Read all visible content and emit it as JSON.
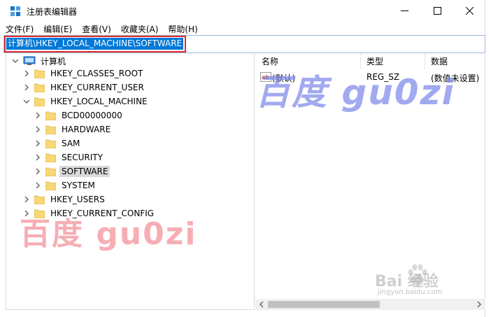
{
  "window": {
    "title": "注册表编辑器"
  },
  "menu": [
    "文件(F)",
    "编辑(E)",
    "查看(V)",
    "收藏夹(A)",
    "帮助(H)"
  ],
  "address": {
    "path": "计算机\\HKEY_LOCAL_MACHINE\\SOFTWARE"
  },
  "tree": {
    "root": "计算机",
    "nodes": [
      {
        "label": "HKEY_CLASSES_ROOT"
      },
      {
        "label": "HKEY_CURRENT_USER"
      },
      {
        "label": "HKEY_LOCAL_MACHINE"
      },
      {
        "label": "BCD00000000"
      },
      {
        "label": "HARDWARE"
      },
      {
        "label": "SAM"
      },
      {
        "label": "SECURITY"
      },
      {
        "label": "SOFTWARE"
      },
      {
        "label": "SYSTEM"
      },
      {
        "label": "HKEY_USERS"
      },
      {
        "label": "HKEY_CURRENT_CONFIG"
      }
    ]
  },
  "list": {
    "columns": [
      "名称",
      "类型",
      "数据"
    ],
    "rows": [
      {
        "name": "(默认)",
        "type": "REG_SZ",
        "data": "(数值未设置)"
      }
    ]
  },
  "watermarks": {
    "right": "百度 gu0zi",
    "left": "百度 gu0zi",
    "brand": "Bai 经验",
    "brand_sub": "jingyan.baidu.com"
  },
  "colors": {
    "selection": "#0078d7",
    "highlight_border": "#e02b2b",
    "folder": "#f8d775"
  }
}
